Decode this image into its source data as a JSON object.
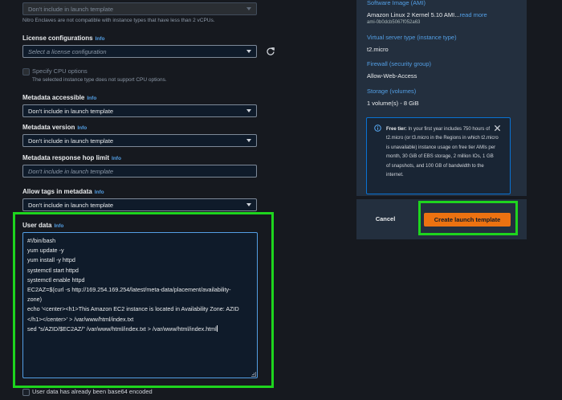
{
  "form": {
    "nitro_select_value": "Don't include in launch template",
    "nitro_hint": "Nitro Enclaves are not compatible with instance types that have less than 2 vCPUs.",
    "license_label": "License configurations",
    "license_placeholder": "Select a license configuration",
    "cpu_label": "Specify CPU options",
    "cpu_hint": "The selected instance type does not support CPU options.",
    "metadata_accessible_label": "Metadata accessible",
    "metadata_accessible_value": "Don't include in launch template",
    "metadata_version_label": "Metadata version",
    "metadata_version_value": "Don't include in launch template",
    "hop_limit_label": "Metadata response hop limit",
    "hop_limit_placeholder": "Don't include in launch template",
    "allow_tags_label": "Allow tags in metadata",
    "allow_tags_value": "Don't include in launch template",
    "user_data_label": "User data",
    "info": "Info",
    "user_data_lines": [
      "#!/bin/bash",
      "yum update -y",
      "yum install -y httpd",
      "systemctl start httpd",
      "systemctl enable httpd",
      "EC2AZ=$(curl -s http://169.254.169.254/latest/meta-data/placement/availability-",
      "zone)",
      "echo '<center><h1>This Amazon EC2 instance is located in Availability Zone: AZID",
      "</h1></center>' > /var/www/html/index.txt",
      "sed \"s/AZID/$EC2AZ/\" /var/www/html/index.txt > /var/www/html/index.html"
    ],
    "base64_label": "User data has already been base64 encoded"
  },
  "summary": {
    "ami_label": "Software Image (AMI)",
    "ami_value": "Amazon Linux 2 Kernel 5.10 AMI...",
    "ami_read_more": "read more",
    "ami_id": "ami-0b0dcb5067f052a63",
    "instance_type_label": "Virtual server type (instance type)",
    "instance_type_value": "t2.micro",
    "firewall_label": "Firewall (security group)",
    "firewall_value": "Allow-Web-Access",
    "storage_label": "Storage (volumes)",
    "storage_value": "1 volume(s) - 8 GiB",
    "free_tier_bold": "Free tier:",
    "free_tier_text": " In your first year includes 750 hours of t2.micro (or t3.micro in the Regions in which t2.micro is unavailable) instance usage on free tier AMIs per month, 30 GiB of EBS storage, 2 million IOs, 1 GB of snapshots, and 100 GB of bandwidth to the internet."
  },
  "actions": {
    "cancel": "Cancel",
    "create": "Create launch template"
  },
  "colors": {
    "highlight": "#1ed51e",
    "primary_button": "#ec7211",
    "link": "#539fe5"
  }
}
